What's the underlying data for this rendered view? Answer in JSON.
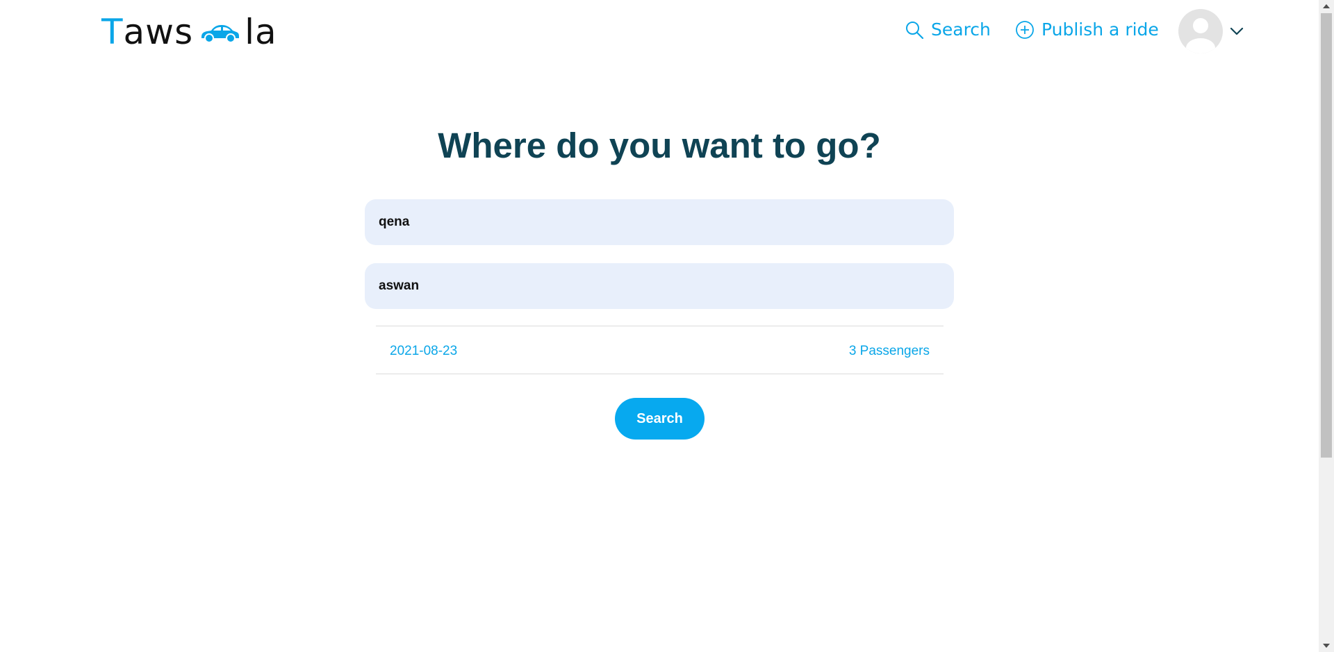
{
  "header": {
    "logo": {
      "first_letter": "T",
      "middle": "aws",
      "end": "la",
      "icon": "car-icon"
    },
    "nav": {
      "search_label": "Search",
      "publish_label": "Publish a ride"
    },
    "profile": {
      "avatar": "avatar",
      "dropdown_icon": "chevron-down-icon"
    }
  },
  "main": {
    "title": "Where do you want to go?",
    "from_value": "qena",
    "to_value": "aswan",
    "date": "2021-08-23",
    "passengers": "3 Passengers",
    "search_button": "Search"
  },
  "colors": {
    "accent": "#0aa6e8",
    "title": "#0f4354",
    "field_bg": "#e8effb",
    "button": "#07a9ef"
  }
}
